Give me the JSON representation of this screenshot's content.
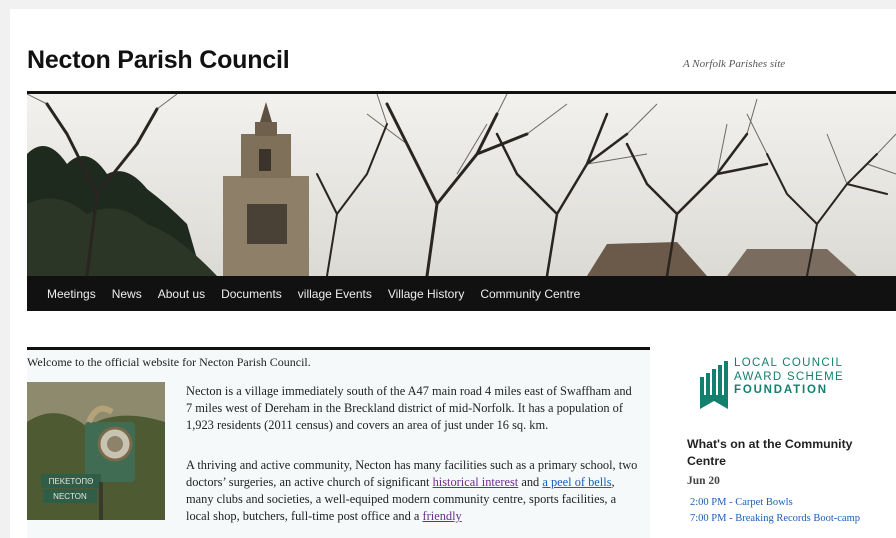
{
  "site": {
    "title": "Necton Parish Council",
    "tagline": "A Norfolk Parishes site"
  },
  "nav": {
    "items": [
      {
        "label": "Meetings"
      },
      {
        "label": "News"
      },
      {
        "label": "About us"
      },
      {
        "label": "Documents"
      },
      {
        "label": "village Events"
      },
      {
        "label": "Village History"
      },
      {
        "label": "Community Centre"
      }
    ]
  },
  "main": {
    "welcome": "Welcome to the official website for Necton Parish Council.",
    "sign_text": {
      "line1": "ΠΕΚΕΤΟΠΘ",
      "line2": "NECTON"
    },
    "para1": "Necton is a village immediately south of the A47 main road 4 miles east of Swaffham and 7 miles west of Dereham in the Breckland district of mid-Norfolk. It has a population of 1,923 residents (2011 census) and covers an area of just under 16 sq. km.",
    "para2": {
      "text1": "A thriving and active community, Necton has many facilities such as a primary school, two doctors’ surgeries, an active church of significant ",
      "link1": "historical interest",
      "text2": " and ",
      "link2": "a peel of bells",
      "text3": ", many clubs and societies, a well-equiped modern community centre, sports facilities, a local shop, butchers, full-time post office and a ",
      "link3": "friendly"
    }
  },
  "sidebar": {
    "badge": {
      "line1": "LOCAL COUNCIL",
      "line2": "AWARD SCHEME",
      "line3": "FOUNDATION"
    },
    "widget_title": "What's on at the Community Centre",
    "date": "Jun 20",
    "events": [
      {
        "text": "2:00 PM - Carpet Bowls"
      },
      {
        "text": "7:00 PM - Breaking Records Boot-camp"
      }
    ]
  },
  "colors": {
    "accent": "#13806f",
    "link": "#1a5fb4",
    "visited_link": "#6b2e8f",
    "nav_bg": "#111111"
  }
}
